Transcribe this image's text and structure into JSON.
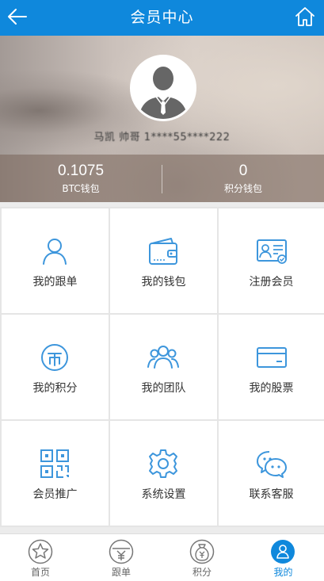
{
  "header": {
    "title": "会员中心",
    "back_icon": "back-arrow-icon",
    "home_icon": "home-icon",
    "bar_color": "#0f88dc"
  },
  "profile": {
    "username": "马凯 帅哥 1****55****222"
  },
  "wallets": [
    {
      "value": "0.1075",
      "label": "BTC钱包"
    },
    {
      "value": "0",
      "label": "积分钱包"
    }
  ],
  "menu": [
    {
      "label": "我的跟单",
      "icon": "user-icon"
    },
    {
      "label": "我的钱包",
      "icon": "wallet-icon"
    },
    {
      "label": "注册会员",
      "icon": "id-card-icon"
    },
    {
      "label": "我的积分",
      "icon": "coin-icon"
    },
    {
      "label": "我的团队",
      "icon": "team-icon"
    },
    {
      "label": "我的股票",
      "icon": "card-icon"
    },
    {
      "label": "会员推广",
      "icon": "qrcode-icon"
    },
    {
      "label": "系统设置",
      "icon": "gear-icon"
    },
    {
      "label": "联系客服",
      "icon": "chat-icon"
    }
  ],
  "tabs": [
    {
      "label": "首页",
      "icon": "star-icon"
    },
    {
      "label": "跟单",
      "icon": "yen-icon"
    },
    {
      "label": "积分",
      "icon": "money-bag-icon"
    },
    {
      "label": "我的",
      "icon": "person-icon",
      "active": true
    }
  ],
  "colors": {
    "accent": "#0f88dc",
    "icon_blue": "#3d96dc",
    "tab_gray": "#777777"
  }
}
